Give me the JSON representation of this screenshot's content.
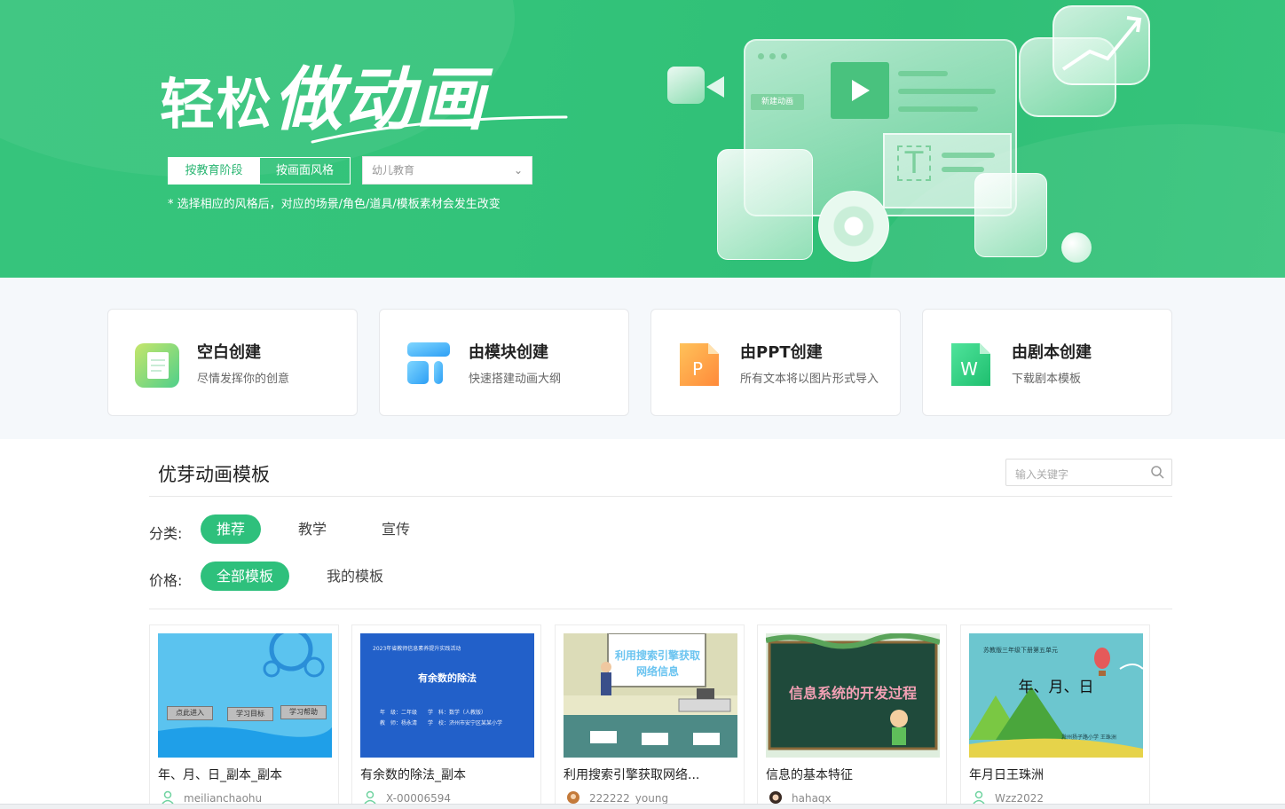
{
  "hero": {
    "title_part1": "轻松",
    "title_part2": "做动画",
    "segment": [
      "按教育阶段",
      "按画面风格"
    ],
    "select_value": "幼儿教育",
    "note": "* 选择相应的风格后，对应的场景/角色/道具/模板素材会发生改变",
    "illustration_tag": "新建动画"
  },
  "create_cards": [
    {
      "title": "空白创建",
      "subtitle": "尽情发挥你的创意",
      "icon": "blank-document-icon"
    },
    {
      "title": "由模块创建",
      "subtitle": "快速搭建动画大纲",
      "icon": "module-blocks-icon"
    },
    {
      "title": "由PPT创建",
      "subtitle": "所有文本将以图片形式导入",
      "icon": "ppt-file-icon"
    },
    {
      "title": "由剧本创建",
      "subtitle": "下载剧本模板",
      "icon": "word-file-icon"
    }
  ],
  "templates": {
    "section_title": "优芽动画模板",
    "search_placeholder": "输入关键字",
    "category_label": "分类:",
    "categories": [
      "推荐",
      "教学",
      "宣传"
    ],
    "price_label": "价格:",
    "prices": [
      "全部模板",
      "我的模板"
    ],
    "items": [
      {
        "name": "年、月、日_副本_副本",
        "user": "meiliancha​ohu",
        "thumb": {
          "buttons": [
            "点此进入",
            "学习目标",
            "学习帮助"
          ]
        }
      },
      {
        "name": "有余数的除法_副本",
        "user": "X-00006594",
        "thumb": {
          "header": "2023年省教师信息素养提升实践活动",
          "title": "有余数的除法",
          "meta1": "年　级：二年级　　学　科：数学（人教版）",
          "meta2": "教　师：杨永清　　学　校：济州市安宁区某某小学"
        }
      },
      {
        "name": "利用搜索引擎获取网络...",
        "user": "222222_young",
        "thumb": {
          "board": "利用搜索引擎获取网络信息"
        }
      },
      {
        "name": "信息的基本特征",
        "user": "hahaqx",
        "thumb": {
          "board": "信息系统的开发过程"
        }
      },
      {
        "name": "年月日王珠洲",
        "user": "Wzz2022",
        "thumb": {
          "header": "苏教版三年级下册第五单元",
          "title": "年、月、日",
          "footer": "滁州扬子路小学 王珠洲"
        }
      }
    ]
  },
  "colors": {
    "brand_green": "#2ec07c",
    "hero_green": "#34c37b"
  }
}
